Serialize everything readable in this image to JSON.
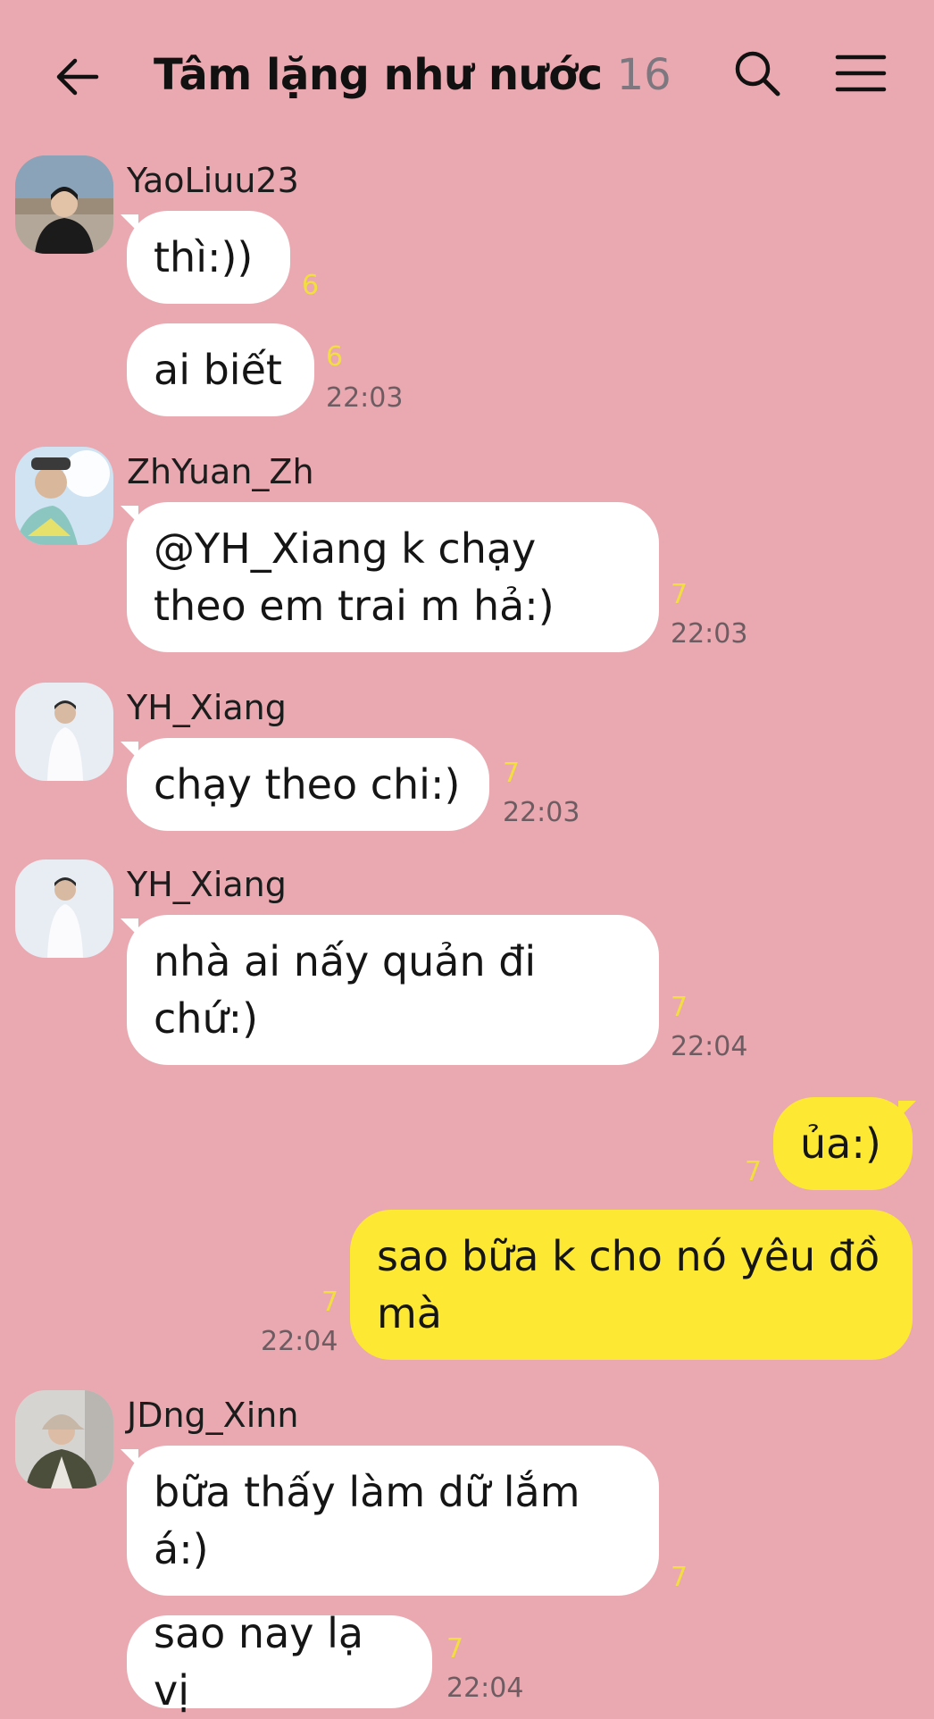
{
  "header": {
    "title": "Tâm lặng như nước",
    "member_count": "16",
    "back_icon": "arrow-left-icon",
    "search_icon": "search-icon",
    "menu_icon": "hamburger-menu-icon"
  },
  "colors": {
    "background": "#eaa9b1",
    "incoming_bubble": "#ffffff",
    "outgoing_bubble": "#fde933",
    "unread_count": "#f2de3d",
    "timestamp": "#6d5d62"
  },
  "messages": [
    {
      "sender": "YaoLiuu23",
      "text": "thì:))",
      "unread": "6"
    },
    {
      "sender": "YaoLiuu23",
      "text": "ai biết",
      "unread": "6",
      "time": "22:03"
    },
    {
      "sender": "ZhYuan_Zh",
      "line1": "@YH_Xiang k chạy",
      "line2": "theo em trai m hả:)",
      "unread": "7",
      "time": "22:03"
    },
    {
      "sender": "YH_Xiang",
      "text": "chạy theo chi:)",
      "unread": "7",
      "time": "22:03"
    },
    {
      "sender": "YH_Xiang",
      "line1": "nhà ai nấy quản đi",
      "line2": "chứ:)",
      "unread": "7",
      "time": "22:04"
    },
    {
      "sender": "me",
      "text": "ủa:)",
      "unread": "7"
    },
    {
      "sender": "me",
      "line1": "sao bữa k cho nó yêu đồ",
      "line2": "mà",
      "unread": "7",
      "time": "22:04"
    },
    {
      "sender": "JDng_Xinn",
      "line1": "bữa thấy làm dữ lắm",
      "line2": "á:)",
      "unread": "7"
    },
    {
      "sender": "JDng_Xinn",
      "text": "sao nay lạ vị",
      "unread": "7",
      "time": "22:04"
    }
  ]
}
